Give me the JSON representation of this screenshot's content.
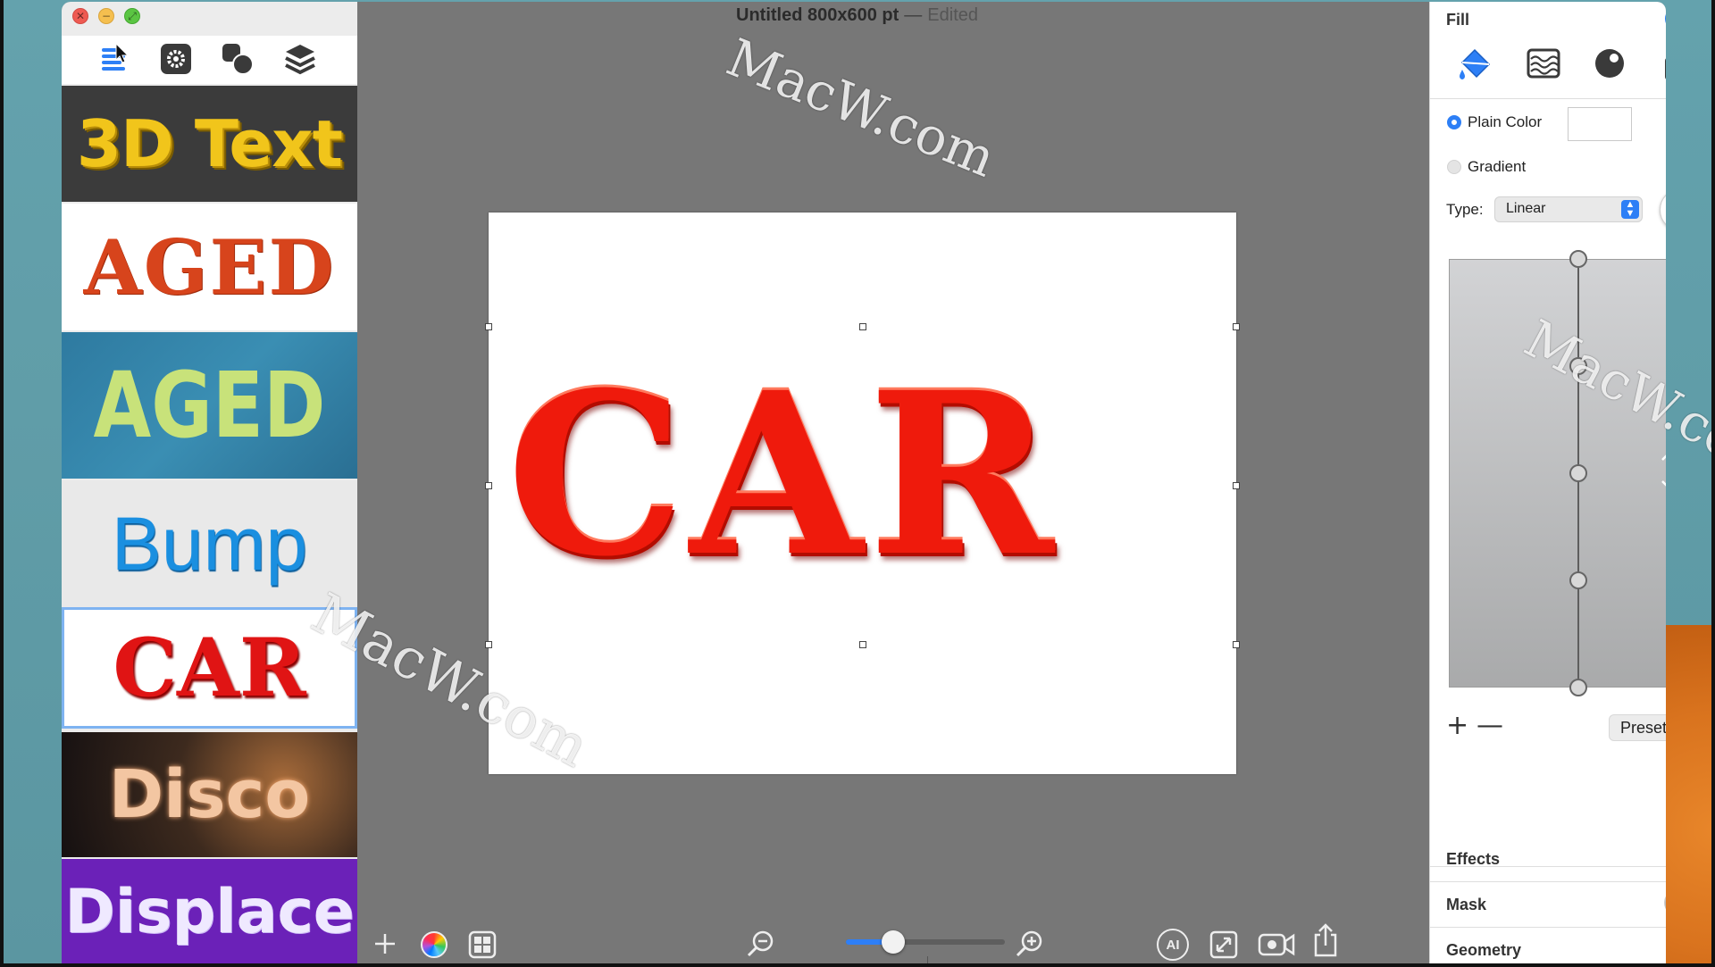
{
  "window": {
    "title": "Untitled 800x600 pt",
    "title_separator": "—",
    "status": "Edited"
  },
  "sidebar": {
    "toolbar_icons": [
      "list-icon",
      "gear-icon",
      "shapes-icon",
      "layers-icon"
    ],
    "presets": [
      {
        "label": "3D Text"
      },
      {
        "label": "AGED"
      },
      {
        "label": "AGED"
      },
      {
        "label": "Bump"
      },
      {
        "label": "CAR",
        "selected": true
      },
      {
        "label": "Disco"
      },
      {
        "label": "Displace"
      }
    ]
  },
  "canvas": {
    "text": "CAR",
    "text_color": "#ef1a0c"
  },
  "bottom_toolbar": {
    "left_icons": [
      "plus-icon",
      "color-wheel-icon",
      "grid-icon"
    ],
    "zoom": {
      "level": 0.3
    },
    "right_icons": [
      "ai-icon",
      "resize-icon",
      "video-icon",
      "share-icon"
    ],
    "ai_label": "AI"
  },
  "panel": {
    "fill": {
      "title": "Fill",
      "enabled": true,
      "tabs": [
        "paint-bucket-icon",
        "texture-icon",
        "sphere-icon",
        "spray-icon"
      ],
      "plain_color_label": "Plain Color",
      "gradient_label": "Gradient",
      "type_label": "Type:",
      "type_value": "Linear",
      "stops": 5,
      "preset_label": "Preset",
      "add_symbol": "+",
      "remove_symbol": "—"
    },
    "effects_label": "Effects",
    "mask_label": "Mask",
    "mask_enabled": false,
    "geometry_label": "Geometry"
  },
  "watermark": "MacW.com",
  "colors": {
    "accent": "#2d7ff6",
    "canvas_bg": "#777777",
    "selection_border": "#7eb3f1"
  }
}
